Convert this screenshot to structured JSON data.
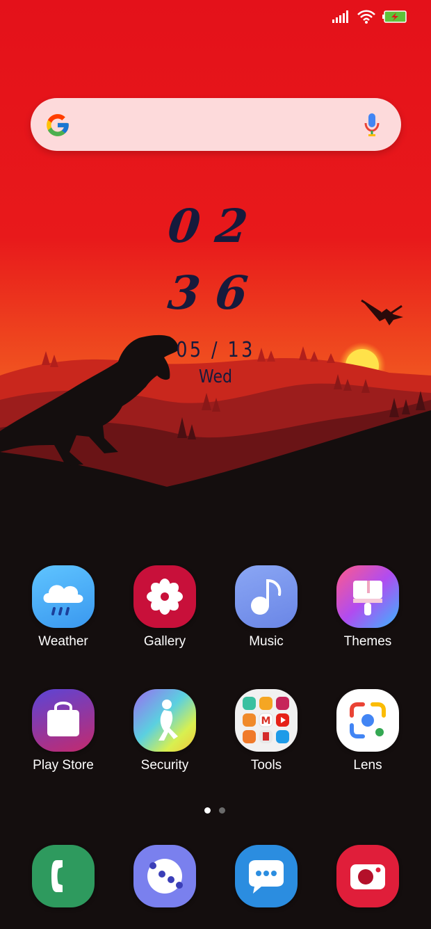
{
  "status_bar": {
    "icons": [
      "signal-icon",
      "wifi-icon",
      "battery-charging-icon"
    ]
  },
  "search": {
    "placeholder": "",
    "icons": [
      "google-g-icon",
      "mic-icon"
    ]
  },
  "clock": {
    "hours": "02",
    "minutes": "36",
    "date": "05 / 13",
    "weekday": "Wed"
  },
  "apps_row1": [
    {
      "label": "Weather",
      "icon": "weather-icon"
    },
    {
      "label": "Gallery",
      "icon": "gallery-icon"
    },
    {
      "label": "Music",
      "icon": "music-icon"
    },
    {
      "label": "Themes",
      "icon": "themes-icon"
    }
  ],
  "apps_row2": [
    {
      "label": "Play Store",
      "icon": "play-store-icon"
    },
    {
      "label": "Security",
      "icon": "security-icon"
    },
    {
      "label": "Tools",
      "icon": "tools-folder-icon"
    },
    {
      "label": "Lens",
      "icon": "lens-icon"
    }
  ],
  "dock": [
    {
      "icon": "phone-icon"
    },
    {
      "icon": "browser-icon"
    },
    {
      "icon": "messages-icon"
    },
    {
      "icon": "camera-icon"
    }
  ],
  "page_indicator": {
    "pages": 2,
    "current": 1
  },
  "colors": {
    "sky_top": "#e4111a",
    "sky_horizon": "#f4621f",
    "ground": "#140e0e",
    "clock_text": "#161a3c"
  }
}
